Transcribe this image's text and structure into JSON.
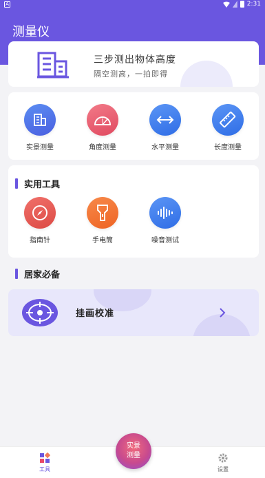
{
  "status_bar": {
    "left_indicator": "A",
    "time": "2:31"
  },
  "header": {
    "title": "测量仪"
  },
  "hero": {
    "headline": "三步测出物体高度",
    "subline": "隔空测高，一拍即得",
    "icon": "building-icon"
  },
  "main_tools": [
    {
      "label": "实景测量",
      "icon": "building-icon",
      "color": "#4a6ee8"
    },
    {
      "label": "角度测量",
      "icon": "protractor-icon",
      "color": "#e95d6f"
    },
    {
      "label": "水平测量",
      "icon": "horizontal-arrow-icon",
      "color": "#3b7cf0"
    },
    {
      "label": "长度测量",
      "icon": "ruler-icon",
      "color": "#3b7cf0"
    }
  ],
  "practical_tools": {
    "title": "实用工具",
    "items": [
      {
        "label": "指南针",
        "icon": "compass-icon",
        "color": "#e85a50"
      },
      {
        "label": "手电筒",
        "icon": "flashlight-icon",
        "color": "#f26b2e"
      },
      {
        "label": "噪音测试",
        "icon": "sound-wave-icon",
        "color": "#3b7cf0"
      }
    ]
  },
  "home_section": {
    "title": "居家必备"
  },
  "banner": {
    "label": "挂画校准",
    "icon": "target-icon"
  },
  "tabbar": {
    "tools_label": "工具",
    "settings_label": "设置",
    "fab_line1": "实景",
    "fab_line2": "测量",
    "active_color": "#6a56e0"
  }
}
